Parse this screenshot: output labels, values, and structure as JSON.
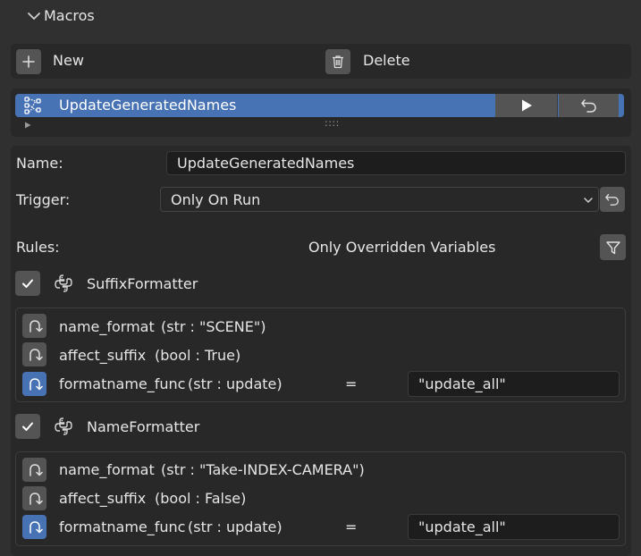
{
  "header": {
    "title": "Macros"
  },
  "toolbar": {
    "new_label": "New",
    "delete_label": "Delete"
  },
  "macro_list": {
    "selected_item": "UpdateGeneratedNames",
    "resize_grip": "::::"
  },
  "props": {
    "name_label": "Name:",
    "name_value": "UpdateGeneratedNames",
    "trigger_label": "Trigger:",
    "trigger_value": "Only On Run",
    "rules_label": "Rules:",
    "rules_filter_text": "Only Overridden Variables"
  },
  "rules": [
    {
      "name": "SuffixFormatter",
      "enabled": true,
      "vars": [
        {
          "name": "name_format",
          "type": "(str : \"SCENE\")",
          "overridden": false
        },
        {
          "name": "affect_suffix",
          "type": "(bool : True)",
          "overridden": false
        },
        {
          "name": "formatname_func",
          "type": "(str : update)",
          "overridden": true,
          "eq": "=",
          "value": "\"update_all\""
        }
      ]
    },
    {
      "name": "NameFormatter",
      "enabled": true,
      "vars": [
        {
          "name": "name_format",
          "type": "(str : \"Take-INDEX-CAMERA\")",
          "overridden": false
        },
        {
          "name": "affect_suffix",
          "type": "(bool : False)",
          "overridden": false
        },
        {
          "name": "formatname_func",
          "type": "(str : update)",
          "overridden": true,
          "eq": "=",
          "value": "\"update_all\""
        }
      ]
    }
  ],
  "colors": {
    "accent": "#4772b3",
    "panel": "#282828",
    "background": "#303030",
    "button": "#545454",
    "field": "#1d1d1d"
  }
}
